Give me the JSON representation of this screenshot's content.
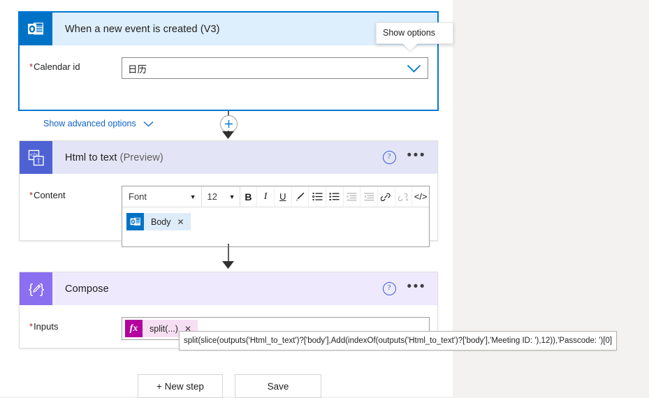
{
  "callout": {
    "text": "Show options",
    "name": "show-options-tooltip"
  },
  "cards": {
    "trigger": {
      "title": "When a new event is created (V3)",
      "icon": "outlook-icon",
      "field_label": "Calendar id",
      "field_required": "*",
      "field_value": "日历",
      "dropdown_icon": "chevron-down-icon",
      "advanced_link": "Show advanced options",
      "advanced_chevron": "chevron-down-icon"
    },
    "html_to_text": {
      "title": "Html to text",
      "title_suffix": "(Preview)",
      "icon": "html-to-text-icon",
      "help_icon": "help-circle-icon",
      "more_icon": "ellipsis-icon",
      "field_label": "Content",
      "field_required": "*",
      "toolbar": {
        "font_label": "Font",
        "font_caret": "chevron-down-icon",
        "size_label": "12",
        "size_caret": "chevron-down-icon",
        "buttons": [
          {
            "name": "bold-icon",
            "glyph": "B",
            "enabled": true
          },
          {
            "name": "italic-icon",
            "glyph": "I",
            "enabled": true
          },
          {
            "name": "underline-icon",
            "glyph": "U",
            "enabled": true
          },
          {
            "name": "highlight-pen-icon",
            "glyph": "pen",
            "enabled": true
          },
          {
            "name": "numbered-list-icon",
            "glyph": "ol",
            "enabled": true
          },
          {
            "name": "bulleted-list-icon",
            "glyph": "ul",
            "enabled": true
          },
          {
            "name": "increase-indent-icon",
            "glyph": "indent",
            "enabled": false
          },
          {
            "name": "decrease-indent-icon",
            "glyph": "outdent",
            "enabled": false
          },
          {
            "name": "insert-link-icon",
            "glyph": "link",
            "enabled": true
          },
          {
            "name": "remove-link-icon",
            "glyph": "unlink",
            "enabled": false
          },
          {
            "name": "code-view-icon",
            "glyph": "</>",
            "enabled": true
          }
        ]
      },
      "token": {
        "label": "Body",
        "icon": "outlook-icon",
        "remove_icon": "close-icon"
      }
    },
    "compose": {
      "title": "Compose",
      "icon": "compose-icon",
      "help_icon": "help-circle-icon",
      "more_icon": "ellipsis-icon",
      "field_label": "Inputs",
      "field_required": "*",
      "token": {
        "label": "split(...)",
        "icon": "fx-icon",
        "remove_icon": "close-icon"
      }
    }
  },
  "expression_tooltip": {
    "text": "split(slice(outputs('Html_to_text')?['body'],Add(indexOf(outputs('Html_to_text')?['body'],'Meeting ID: '),12)),'Passcode: ')[0]"
  },
  "footer": {
    "new_step": "+ New step",
    "save": "Save"
  },
  "colors": {
    "trigger_border": "#0078d4",
    "trigger_header": "#ddeefc",
    "outlook_icon_bg": "#0072c6",
    "html_icon_bg": "#4e62d4",
    "html_header": "#e3e5f6",
    "compose_icon_bg": "#8a6ff0",
    "compose_header": "#eee9fd",
    "required_asterisk": "#a4262c",
    "link": "#0f62c4",
    "fx_token": "#b4009e",
    "body_token": "#deecf9"
  }
}
